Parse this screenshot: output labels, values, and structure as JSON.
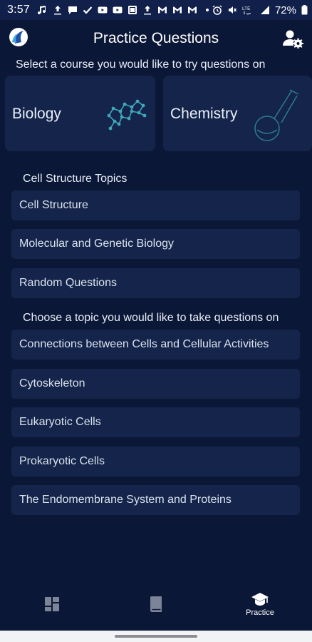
{
  "status_bar": {
    "time": "3:57",
    "battery": "72%",
    "lte": "LTE",
    "icons_left": [
      "music-note-icon",
      "upload-icon",
      "chat-icon",
      "check-icon",
      "youtube-icon",
      "youtube-icon",
      "photo-icon",
      "upload-icon",
      "gmail-icon",
      "gmail-icon",
      "gmail-icon",
      "dot-icon"
    ],
    "icons_right": [
      "alarm-icon",
      "mute-icon",
      "lte-icon",
      "signal-icon",
      "battery-icon"
    ]
  },
  "header": {
    "title": "Practice Questions",
    "logo_icon": "app-logo-icon",
    "profile_icon": "user-settings-icon"
  },
  "intro": "Select a course you would like to try questions on",
  "courses": [
    {
      "label": "Biology",
      "icon": "molecule-network-icon"
    },
    {
      "label": "Chemistry",
      "icon": "flask-icon"
    }
  ],
  "cell_structure_topics": {
    "title": "Cell Structure Topics",
    "items": [
      "Cell Structure",
      "Molecular and Genetic Biology",
      "Random Questions"
    ]
  },
  "choose_topic": {
    "title": "Choose a topic you would like to take questions on",
    "items": [
      "Connections between Cells and Cellular Activities",
      "Cytoskeleton",
      "Eukaryotic Cells",
      "Prokaryotic Cells",
      "The Endomembrane System and Proteins"
    ]
  },
  "bottom_nav": {
    "items": [
      {
        "icon": "dashboard-icon",
        "label": ""
      },
      {
        "icon": "book-icon",
        "label": ""
      },
      {
        "icon": "graduation-cap-icon",
        "label": "Practice",
        "active": true
      }
    ]
  },
  "colors": {
    "background": "#0b1736",
    "card": "#14244a",
    "accent_art": "#3fa7b8"
  }
}
